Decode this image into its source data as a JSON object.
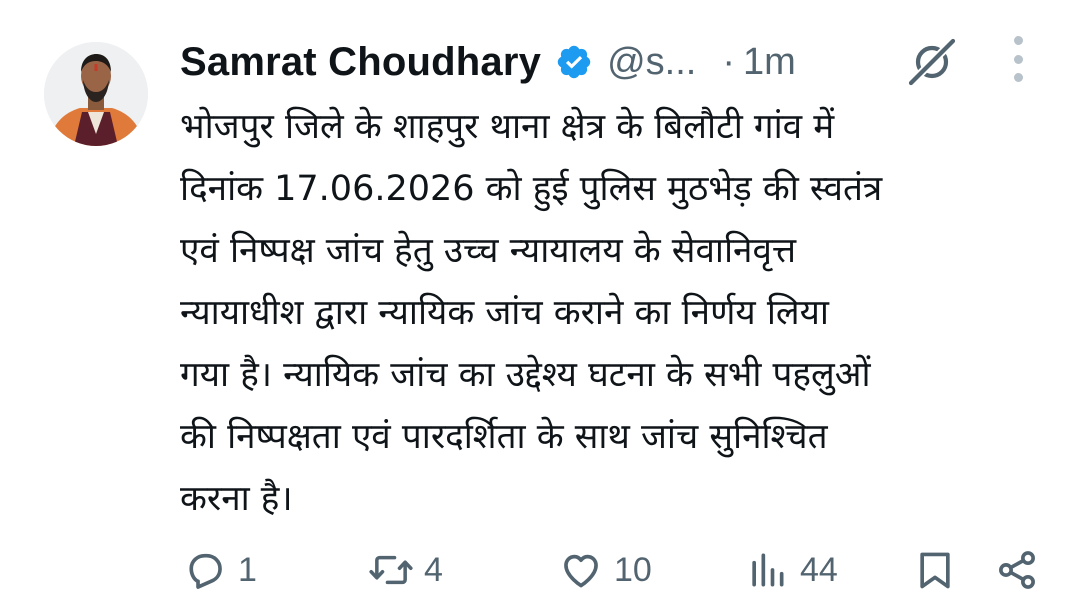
{
  "tweet": {
    "author_name": "Samrat Choudhary",
    "handle": "@s...",
    "separator": "·",
    "time": "1m",
    "text_lines": [
      "भोजपुर जिले के शाहपुर थाना क्षेत्र के बिलौटी गांव में",
      "दिनांक 17.06.2026 को हुई पुलिस मुठभेड़ की स्वतंत्र",
      "एवं निष्पक्ष जांच हेतु उच्च न्यायालय के सेवानिवृत्त",
      "न्यायाधीश द्वारा न्यायिक जांच कराने का निर्णय लिया",
      "गया है। न्यायिक जांच का उद्देश्य घटना के सभी पहलुओं",
      "की निष्पक्षता एवं पारदर्शिता के साथ जांच सुनिश्चित",
      "करना है।"
    ]
  },
  "actions": {
    "replies": "1",
    "reposts": "4",
    "likes": "10",
    "views": "44"
  },
  "icons": {
    "verified": "verified-badge-icon",
    "grok": "grok-icon",
    "more": "more-options-icon",
    "reply": "reply-icon",
    "repost": "repost-icon",
    "like": "heart-icon",
    "views": "views-icon",
    "bookmark": "bookmark-icon",
    "share": "share-icon"
  },
  "colors": {
    "text": "#0f1419",
    "secondary": "#536471",
    "verified": "#1d9bf0"
  }
}
